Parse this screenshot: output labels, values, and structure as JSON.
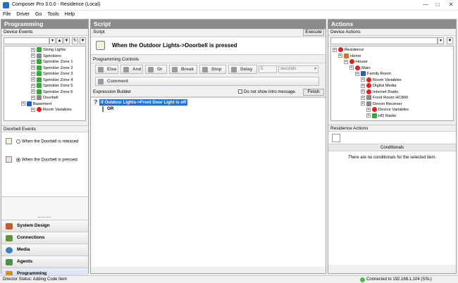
{
  "window": {
    "title": "Composer Pro 3.0.0 - Residence (Local)"
  },
  "menu": [
    "File",
    "Driver",
    "Go",
    "Tools",
    "Help"
  ],
  "left": {
    "header": "Programming",
    "device_events_label": "Device Events",
    "tree": [
      {
        "label": "String Lights",
        "indent": 2,
        "icon": "green"
      },
      {
        "label": "Sprinklers",
        "indent": 2,
        "icon": "gray"
      },
      {
        "label": "Sprinkler Zone 1",
        "indent": 2,
        "icon": "green"
      },
      {
        "label": "Sprinkler Zone 2",
        "indent": 2,
        "icon": "green"
      },
      {
        "label": "Sprinkler Zone 3",
        "indent": 2,
        "icon": "green"
      },
      {
        "label": "Sprinkler Zone 4",
        "indent": 2,
        "icon": "green"
      },
      {
        "label": "Sprinkler Zone 5",
        "indent": 2,
        "icon": "green"
      },
      {
        "label": "Sprinkler Zone 6",
        "indent": 2,
        "icon": "green"
      },
      {
        "label": "Doorbell",
        "indent": 2,
        "icon": "gray"
      },
      {
        "label": "Basement",
        "indent": 1,
        "icon": "blue"
      },
      {
        "label": "Room Variables",
        "indent": 2,
        "icon": "red"
      }
    ],
    "doorbell_events_label": "Doorbell Events",
    "events": [
      {
        "label": "When the Doorbell is released",
        "selected": false
      },
      {
        "label": "When the Doorbell is pressed",
        "selected": true
      }
    ],
    "nav": [
      "System Design",
      "Connections",
      "Media",
      "Agents",
      "Programming"
    ]
  },
  "center": {
    "header": "Script",
    "script_label": "Script",
    "execute_label": "Execute",
    "script_title": "When the Outdoor Lights->Doorbell is pressed",
    "controls_label": "Programming Controls",
    "controls": [
      "Else",
      "And",
      "Or",
      "Break",
      "Stop",
      "Delay"
    ],
    "delay_value": "5",
    "delay_unit": "seconds",
    "comment_label": "Comment",
    "expr_label": "Expression Builder",
    "intro_checkbox_label": "Do not show intro message.",
    "finish_label": "Finish",
    "expression_line": "If Outdoor Lights->Front Door Light is off",
    "expression_or": "OR"
  },
  "right": {
    "header": "Actions",
    "device_actions_label": "Device Actions",
    "tree": [
      {
        "label": "Residence",
        "indent": 0,
        "icon": "red"
      },
      {
        "label": "Home",
        "indent": 1,
        "icon": "home"
      },
      {
        "label": "House",
        "indent": 2,
        "icon": "red"
      },
      {
        "label": "Main",
        "indent": 3,
        "icon": "red"
      },
      {
        "label": "Family Room",
        "indent": 4,
        "icon": "blue"
      },
      {
        "label": "Room Variables",
        "indent": 5,
        "icon": "red"
      },
      {
        "label": "Digital Media",
        "indent": 5,
        "icon": "red"
      },
      {
        "label": "Internet Radio",
        "indent": 5,
        "icon": "red"
      },
      {
        "label": "Front Room HC800",
        "indent": 5,
        "icon": "gray"
      },
      {
        "label": "Denon Receiver",
        "indent": 5,
        "icon": "gray"
      },
      {
        "label": "Device Variables",
        "indent": 6,
        "icon": "red"
      },
      {
        "label": "HD Radio",
        "indent": 6,
        "icon": "green"
      }
    ],
    "residence_actions_label": "Residence Actions",
    "conditionals_label": "Conditionals",
    "conditionals_empty": "There are no conditionals for the selected item."
  },
  "status": {
    "left": "Director Status: Adding Code Item",
    "right": "Connected to 192.168.1.104 (SSL)"
  }
}
